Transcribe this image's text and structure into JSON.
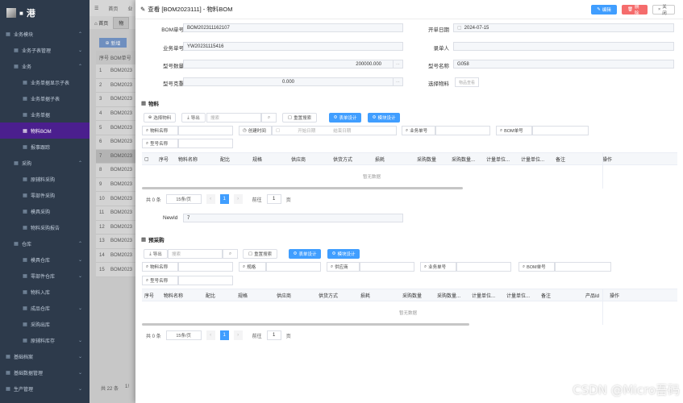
{
  "logo": {
    "text": "港"
  },
  "sidebar": {
    "items": [
      {
        "icon": "grid",
        "label": "业务模块",
        "level": 0,
        "arrow": "⌃",
        "active": false
      },
      {
        "icon": "grid",
        "label": "业务子表管理",
        "level": 1,
        "arrow": "⌄",
        "active": false
      },
      {
        "icon": "grid",
        "label": "业务",
        "level": 1,
        "arrow": "⌃",
        "active": false
      },
      {
        "icon": "grid",
        "label": "业务单据显示子表",
        "level": 2,
        "arrow": "",
        "active": false
      },
      {
        "icon": "grid",
        "label": "业务单据子表",
        "level": 2,
        "arrow": "",
        "active": false
      },
      {
        "icon": "grid",
        "label": "业务单据",
        "level": 2,
        "arrow": "",
        "active": false
      },
      {
        "icon": "grid",
        "label": "物料BOM",
        "level": 2,
        "arrow": "",
        "active": true
      },
      {
        "icon": "grid",
        "label": "报事跟踪",
        "level": 2,
        "arrow": "",
        "active": false
      },
      {
        "icon": "grid",
        "label": "采购",
        "level": 1,
        "arrow": "⌃",
        "active": false
      },
      {
        "icon": "grid",
        "label": "原辅料采购",
        "level": 2,
        "arrow": "",
        "active": false
      },
      {
        "icon": "grid",
        "label": "零部件采购",
        "level": 2,
        "arrow": "",
        "active": false
      },
      {
        "icon": "grid",
        "label": "模具采购",
        "level": 2,
        "arrow": "",
        "active": false
      },
      {
        "icon": "grid",
        "label": "物料采购报告",
        "level": 2,
        "arrow": "",
        "active": false
      },
      {
        "icon": "grid",
        "label": "仓库",
        "level": 1,
        "arrow": "⌃",
        "active": false
      },
      {
        "icon": "grid",
        "label": "模具仓库",
        "level": 2,
        "arrow": "⌄",
        "active": false
      },
      {
        "icon": "grid",
        "label": "零部件仓库",
        "level": 2,
        "arrow": "⌄",
        "active": false
      },
      {
        "icon": "grid",
        "label": "物料入库",
        "level": 2,
        "arrow": "",
        "active": false
      },
      {
        "icon": "grid",
        "label": "成品仓库",
        "level": 2,
        "arrow": "⌄",
        "active": false
      },
      {
        "icon": "grid",
        "label": "采购出库",
        "level": 2,
        "arrow": "",
        "active": false
      },
      {
        "icon": "grid",
        "label": "原辅料库存",
        "level": 2,
        "arrow": "⌄",
        "active": false
      },
      {
        "icon": "grid",
        "label": "基础档案",
        "level": 0,
        "arrow": "⌄",
        "active": false
      },
      {
        "icon": "grid",
        "label": "基础数据管理",
        "level": 0,
        "arrow": "⌄",
        "active": false
      },
      {
        "icon": "grid",
        "label": "生产管理",
        "level": 0,
        "arrow": "⌄",
        "active": false
      }
    ]
  },
  "topbar": {
    "home": "首页",
    "crumb": "业"
  },
  "tabs": {
    "home": "首页",
    "current": "物"
  },
  "background": {
    "add_label": "新增",
    "col_index": "序号",
    "col_bom": "BOM单号",
    "rows": [
      "1",
      "2",
      "3",
      "4",
      "5",
      "6",
      "7",
      "8",
      "9",
      "10",
      "11",
      "12",
      "13",
      "14",
      "15"
    ],
    "bom_prefix": "BOM2023",
    "total": "共 22 条",
    "pager_hint": "1!"
  },
  "dialog": {
    "title": "查看 [BOM2023111] - 物料BOM",
    "edit_label": "编辑",
    "delete_label": "删除",
    "close_label": "关闭",
    "form": {
      "bom_no_label": "BOM单号",
      "bom_no": "BOM202311162107",
      "start_date_label": "开单日期",
      "start_date": "2024-07-15",
      "biz_no_label": "业务单号",
      "biz_no": "YW20231115416",
      "recorder_label": "录单人",
      "recorder": "",
      "qty_label": "型号数量",
      "qty": "200000.000",
      "model_name_label": "型号名称",
      "model_name": "G058",
      "weight_label": "型号克重",
      "weight": "0.000",
      "select_material_label": "选择物料",
      "select_material_placeholder": "物品查看"
    },
    "material": {
      "section_title": "物料",
      "btn_select": "选择物料",
      "btn_export": "导出",
      "search_placeholder": "搜索",
      "btn_reset": "重置搜索",
      "btn_form_design": "表单设计",
      "btn_module_design": "模块设计",
      "filter_material_name": "物料名称",
      "filter_create_time": "创建时间",
      "date_start": "开始日期",
      "date_end": "结束日期",
      "filter_biz_no": "业务单号",
      "filter_bom_no": "BOM单号",
      "filter_model_name": "型号名称",
      "columns": [
        "序号",
        "物料名称",
        "配比",
        "规格",
        "供应商",
        "供货方式",
        "损耗",
        "采购数量",
        "采购数量...",
        "计量单位...",
        "计量单位...",
        "备注",
        "",
        "操作"
      ],
      "empty_text": "暂无数据",
      "pager": {
        "total": "共 0 条",
        "size": "15条/页",
        "page": "1",
        "goto": "前往",
        "goto_page": "1",
        "page_unit": "页"
      }
    },
    "newid": {
      "label": "NewId",
      "value": "7"
    },
    "pre_purchase": {
      "section_title": "预采购",
      "btn_export": "导出",
      "search_placeholder": "搜索",
      "btn_reset": "重置搜索",
      "btn_form_design": "表单设计",
      "btn_module_design": "模块设计",
      "filter_material_name": "物料名称",
      "filter_spec": "规格",
      "filter_supplier": "供应商",
      "filter_biz_no": "业务单号",
      "filter_bom_no": "BOM单号",
      "filter_model_name": "型号名称",
      "columns": [
        "序号",
        "物料名称",
        "配比",
        "规格",
        "供应商",
        "供货方式",
        "损耗",
        "采购数量",
        "采购数量...",
        "计量单位...",
        "计量单位...",
        "备注",
        "产品Id",
        "操作"
      ],
      "empty_text": "暂无数据",
      "pager": {
        "total": "共 0 条",
        "size": "15条/页",
        "page": "1",
        "goto": "前往",
        "goto_page": "1",
        "page_unit": "页"
      }
    }
  },
  "watermark": "CSDN @Micro吾码",
  "colors": {
    "primary": "#409eff",
    "danger": "#f56c6c",
    "sidebar": "#2d3a4b",
    "active": "#4b1f8e"
  }
}
